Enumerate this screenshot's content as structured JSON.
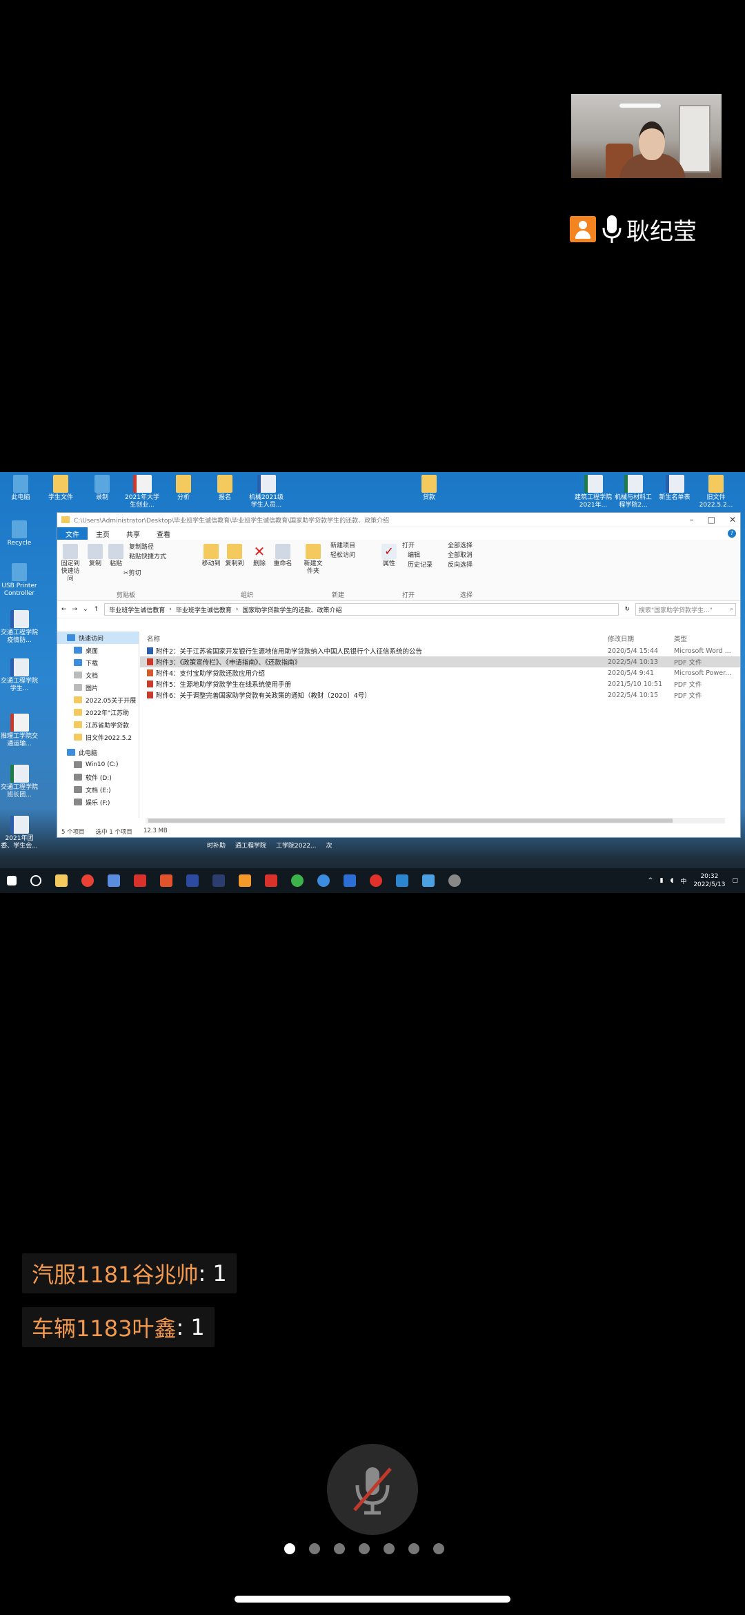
{
  "speaker": {
    "name": "耿纪莹"
  },
  "desktop": {
    "icons_top": [
      "此电脑",
      "学生文件",
      "录制",
      "2021年大学生创业...",
      "分析",
      "报名",
      "机械2021级学生人员...",
      "贷款"
    ],
    "icons_right": [
      "建筑工程学院2021年...",
      "机械与材料工程学院2...",
      "新生名单表",
      "旧文件2022.5.2..."
    ],
    "icons_left": [
      "Recycle",
      "USB Printer Controller",
      "交通工程学院疫情防...",
      "交通工程学院学生...",
      "推理工学院交通运输...",
      "交通工程学院班长团...",
      "2021年团委、学生会..."
    ]
  },
  "explorer": {
    "path_title": "C:\\Users\\Administrator\\Desktop\\毕业班学生诚信教育\\毕业班学生诚信教育\\国家助学贷款学生的还款、政策介绍",
    "tabs": [
      "文件",
      "主页",
      "共享",
      "查看"
    ],
    "ribbon": {
      "pin": "固定到快速访问",
      "copy": "复制",
      "paste": "粘贴",
      "copy_path": "复制路径",
      "paste_shortcut": "粘贴快捷方式",
      "cut": "剪切",
      "move_to": "移动到",
      "copy_to": "复制到",
      "delete": "删除",
      "rename": "重命名",
      "new_folder": "新建文件夹",
      "new_item": "新建项目",
      "easy_access": "轻松访问",
      "properties": "属性",
      "open": "打开",
      "edit": "编辑",
      "history": "历史记录",
      "select_all": "全部选择",
      "select_none": "全部取消",
      "invert": "反向选择",
      "groups": [
        "剪贴板",
        "组织",
        "新建",
        "打开",
        "选择"
      ]
    },
    "breadcrumb": [
      "毕业班学生诚信教育",
      "毕业班学生诚信教育",
      "国家助学贷款学生的还款、政策介绍"
    ],
    "search_placeholder": "搜索\"国家助学贷款学生...\"",
    "nav": [
      {
        "label": "快速访问"
      },
      {
        "label": "桌面"
      },
      {
        "label": "下载"
      },
      {
        "label": "文档"
      },
      {
        "label": "图片"
      },
      {
        "label": "2022.05关于开展"
      },
      {
        "label": "2022年\"江苏助"
      },
      {
        "label": "江苏省助学贷款"
      },
      {
        "label": "旧文件2022.5.2"
      },
      {
        "label": "此电脑"
      },
      {
        "label": "Win10 (C:)"
      },
      {
        "label": "软件 (D:)"
      },
      {
        "label": "文档 (E:)"
      },
      {
        "label": "娱乐 (F:)"
      }
    ],
    "columns": {
      "name": "名称",
      "date": "修改日期",
      "type": "类型"
    },
    "files": [
      {
        "name": "附件2：关于江苏省国家开发银行生源地信用助学贷款纳入中国人民银行个人征信系统的公告",
        "date": "2020/5/4 15:44",
        "type": "Microsoft Word ..."
      },
      {
        "name": "附件3：《政策宣传栏》、《申请指南》、《还款指南》",
        "date": "2022/5/4 10:13",
        "type": "PDF 文件"
      },
      {
        "name": "附件4：支付宝助学贷款还款应用介绍",
        "date": "2020/5/4 9:41",
        "type": "Microsoft Power..."
      },
      {
        "name": "附件5：生源地助学贷款学生在线系统使用手册",
        "date": "2021/5/10 10:51",
        "type": "PDF 文件"
      },
      {
        "name": "附件6：关于调整完善国家助学贷款有关政策的通知（教财〔2020〕4号）",
        "date": "2022/5/4 10:15",
        "type": "PDF 文件"
      }
    ],
    "status": {
      "count": "5 个项目",
      "selected": "选中 1 个项目",
      "size": "12.3 MB"
    }
  },
  "bottom_names": [
    "时补助",
    "通工程学院",
    "工学院2022...",
    "次"
  ],
  "taskbar": {
    "time": "20:32",
    "date": "2022/5/13",
    "ime": "中"
  },
  "comments": [
    {
      "name": "汽服1181谷兆帅",
      "text": ": 1"
    },
    {
      "name": "车辆1183叶鑫",
      "text": ": 1"
    }
  ],
  "pager": {
    "count": 7,
    "active": 0
  },
  "colors": {
    "accent": "#f3841f",
    "comment_name": "#f39a4e",
    "win_blue": "#1979ca"
  }
}
